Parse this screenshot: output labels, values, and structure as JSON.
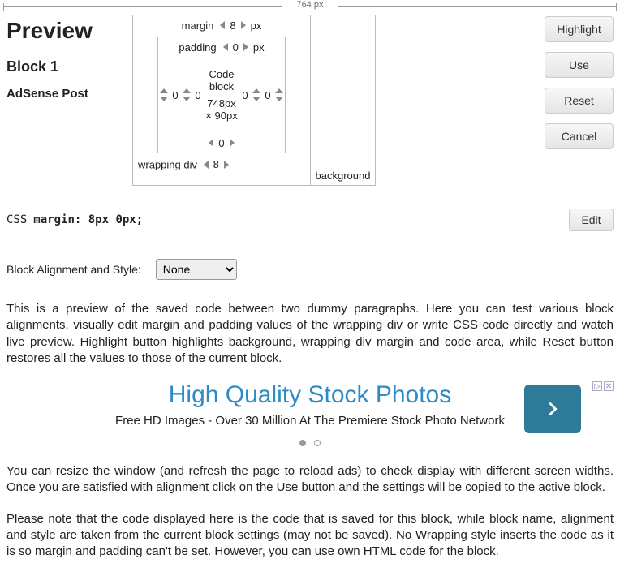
{
  "ruler_label": "764 px",
  "header": {
    "preview": "Preview",
    "block": "Block 1",
    "name": "AdSense Post"
  },
  "buttons": {
    "highlight": "Highlight",
    "use": "Use",
    "reset": "Reset",
    "cancel": "Cancel",
    "edit": "Edit"
  },
  "editor": {
    "margin_label": "margin",
    "margin_top": "8",
    "margin_unit": "px",
    "padding_label": "padding",
    "padding_top": "0",
    "padding_unit": "px",
    "margin_left": "0",
    "padding_left": "0",
    "padding_right": "0",
    "margin_right": "0",
    "code_block_label": "Code block",
    "code_dims": "748px × 90px",
    "padding_bottom": "0",
    "wrapping_label": "wrapping div",
    "wrapping_value": "8",
    "background_label": "background"
  },
  "css": {
    "label": "CSS",
    "code": "margin: 8px 0px;"
  },
  "alignment": {
    "label": "Block Alignment and Style:",
    "selected": "None"
  },
  "paragraphs": {
    "p1": "This is a preview of the saved code between two dummy paragraphs. Here you can test various block alignments, visually edit margin and padding values of the wrapping div or write CSS code directly and watch live preview. Highlight button highlights background, wrapping div margin and code area, while Reset button restores all the values to those of the current block.",
    "p2": "You can resize the window (and refresh the page to reload ads) to check display with different screen widths. Once you are satisfied with alignment click on the Use button and the settings will be copied to the active block.",
    "p3": "Please note that the code displayed here is the code that is saved for this block, while block name, alignment and style are taken from the current block settings (may not be saved). No Wrapping style inserts the code as it is so margin and padding can't be set. However, you can use own HTML code for the block."
  },
  "ad": {
    "headline": "High Quality Stock Photos",
    "sub": "Free HD Images - Over 30 Million At The Premiere Stock Photo Network"
  }
}
